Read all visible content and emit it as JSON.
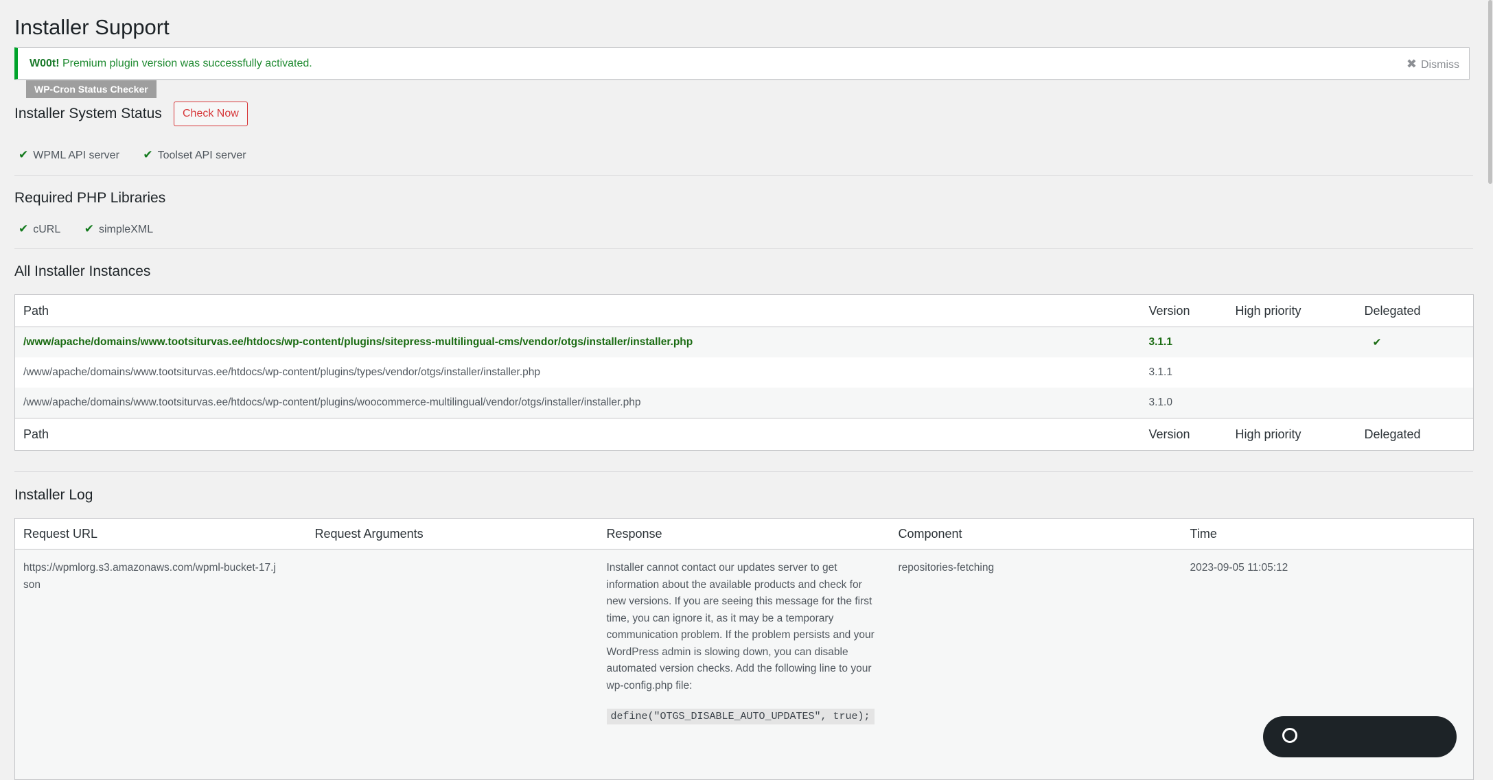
{
  "page": {
    "title": "Installer Support"
  },
  "notice": {
    "strong": "W00t!",
    "message": " Premium plugin version was successfully activated.",
    "dismiss_label": "Dismiss"
  },
  "cron_badge": "WP-Cron Status Checker",
  "system_status": {
    "title": "Installer System Status",
    "check_button": "Check Now",
    "servers": [
      {
        "label": "WPML API server",
        "ok": true
      },
      {
        "label": "Toolset API server",
        "ok": true
      }
    ]
  },
  "php_libraries": {
    "title": "Required PHP Libraries",
    "items": [
      {
        "label": "cURL",
        "ok": true
      },
      {
        "label": "simpleXML",
        "ok": true
      }
    ]
  },
  "instances": {
    "title": "All Installer Instances",
    "columns": [
      "Path",
      "Version",
      "High priority",
      "Delegated"
    ],
    "rows": [
      {
        "path": "/www/apache/domains/www.tootsiturvas.ee/htdocs/wp-content/plugins/sitepress-multilingual-cms/vendor/otgs/installer/installer.php",
        "version": "3.1.1",
        "high_priority": "",
        "delegated": "✔",
        "active": true
      },
      {
        "path": "/www/apache/domains/www.tootsiturvas.ee/htdocs/wp-content/plugins/types/vendor/otgs/installer/installer.php",
        "version": "3.1.1",
        "high_priority": "",
        "delegated": "",
        "active": false
      },
      {
        "path": "/www/apache/domains/www.tootsiturvas.ee/htdocs/wp-content/plugins/woocommerce-multilingual/vendor/otgs/installer/installer.php",
        "version": "3.1.0",
        "high_priority": "",
        "delegated": "",
        "active": false
      }
    ]
  },
  "log": {
    "title": "Installer Log",
    "columns": [
      "Request URL",
      "Request Arguments",
      "Response",
      "Component",
      "Time"
    ],
    "rows": [
      {
        "request_url": "https://wpmlorg.s3.amazonaws.com/wpml-bucket-17.json",
        "request_arguments": "",
        "response": "Installer cannot contact our updates server to get information about the available products and check for new versions. If you are seeing this message for the first time, you can ignore it, as it may be a temporary communication problem. If the problem persists and your WordPress admin is slowing down, you can disable automated version checks. Add the following line to your wp-config.php file:",
        "response_code": "define(\"OTGS_DISABLE_AUTO_UPDATES\", true);",
        "component": "repositories-fetching",
        "time": "2023-09-05 11:05:12"
      }
    ]
  },
  "icons": {
    "check": "check-icon",
    "dismiss": "close-icon",
    "chat": "chat-icon"
  },
  "colors": {
    "success": "#00a32a",
    "danger": "#d63638",
    "check": "#137a1d",
    "active_path": "#1a6b12"
  }
}
